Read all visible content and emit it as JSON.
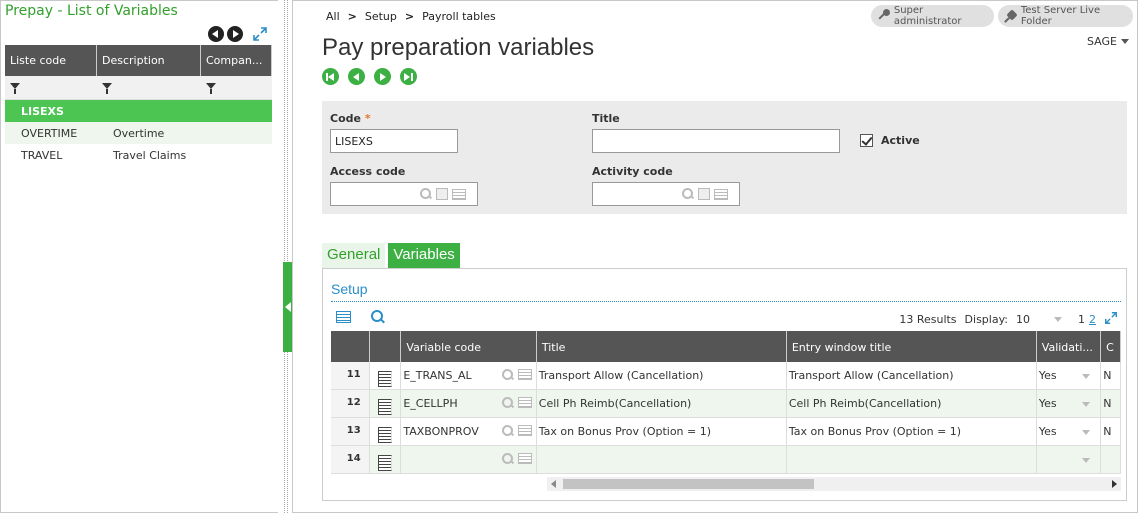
{
  "left_panel": {
    "title": "Prepay - List of Variables",
    "columns": [
      "Liste code",
      "Description",
      "Compan..."
    ],
    "rows": [
      {
        "code": "LISEXS",
        "description": "",
        "company": ""
      },
      {
        "code": "OVERTIME",
        "description": "Overtime",
        "company": ""
      },
      {
        "code": "TRAVEL",
        "description": "Travel Claims",
        "company": ""
      }
    ]
  },
  "breadcrumb": {
    "items": [
      "All",
      "Setup",
      "Payroll tables"
    ],
    "separator": ">"
  },
  "header": {
    "user_label": "Super administrator",
    "folder_label": "Test Server Live Folder",
    "sage_menu": "SAGE",
    "page_title": "Pay preparation variables"
  },
  "form": {
    "code_label": "Code",
    "code_required": "*",
    "code_value": "LISEXS",
    "title_label": "Title",
    "title_value": "",
    "active_label": "Active",
    "active_checked": true,
    "access_code_label": "Access code",
    "access_code_value": "",
    "activity_code_label": "Activity code",
    "activity_code_value": ""
  },
  "tabs": {
    "general": "General",
    "variables": "Variables"
  },
  "section": {
    "title": "Setup",
    "results": "13 Results",
    "display_label": "Display:",
    "display_value": "10",
    "page_current": "1",
    "page_next": "2"
  },
  "variables_grid": {
    "columns": [
      "",
      "",
      "Variable code",
      "Title",
      "Entry window title",
      "Validati...",
      "C"
    ],
    "rows": [
      {
        "num": "11",
        "code": "E_TRANS_AL",
        "title": "Transport Allow (Cancellation)",
        "entry": "Transport Allow (Cancellation)",
        "validation": "Yes",
        "c": "N"
      },
      {
        "num": "12",
        "code": "E_CELLPH",
        "title": "Cell Ph Reimb(Cancellation)",
        "entry": "Cell Ph Reimb(Cancellation)",
        "validation": "Yes",
        "c": "N"
      },
      {
        "num": "13",
        "code": "TAXBONPROV",
        "title": "Tax on Bonus Prov (Option = 1)",
        "entry": "Tax on Bonus Prov (Option = 1)",
        "validation": "Yes",
        "c": "N"
      },
      {
        "num": "14",
        "code": "",
        "title": "",
        "entry": "",
        "validation": "",
        "c": ""
      }
    ]
  },
  "colors": {
    "accent_green": "#3cb043",
    "selected_row": "#4cc552",
    "link_blue": "#2a8fc8",
    "header_dark": "#555555"
  }
}
